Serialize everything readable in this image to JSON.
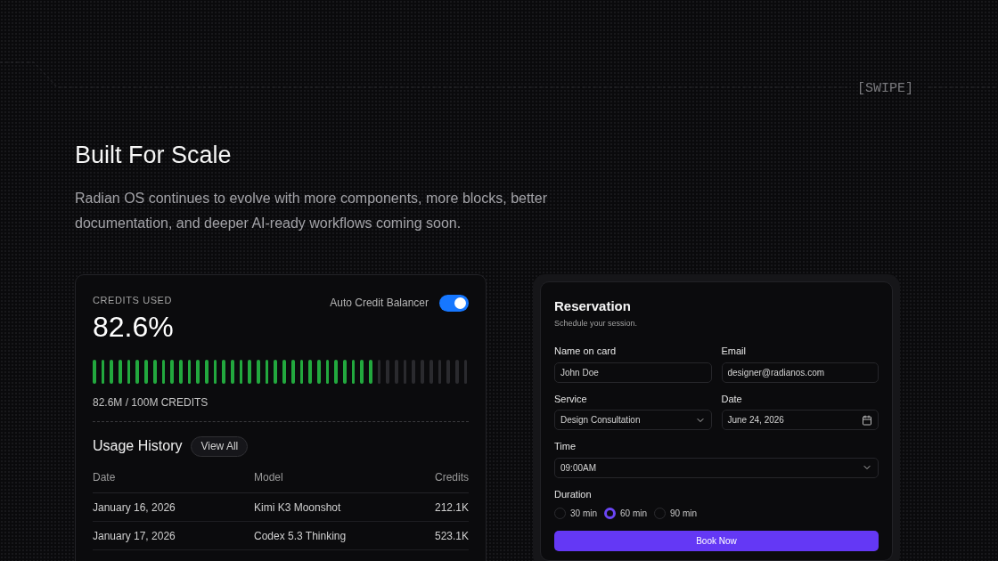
{
  "swipe_label": "[SWIPE]",
  "hero": {
    "title": "Built For Scale",
    "description": "Radian OS continues to evolve with more components, more blocks, better documentation, and deeper AI-ready workflows coming soon."
  },
  "credits_card": {
    "label": "CREDITS USED",
    "percent": "82.6%",
    "toggle": {
      "label": "Auto Credit Balancer",
      "on": true
    },
    "meter": {
      "level": 0.76
    },
    "usage": "82.6M / 100M CREDITS",
    "history": {
      "title": "Usage History",
      "button": "View All",
      "columns": [
        "Date",
        "Model",
        "Credits"
      ],
      "rows": [
        [
          "January 16, 2026",
          "Kimi K3 Moonshot",
          "212.1K"
        ],
        [
          "January 17, 2026",
          "Codex 5.3 Thinking",
          "523.1K"
        ]
      ]
    }
  },
  "reservation": {
    "title": "Reservation",
    "subtitle": "Schedule your session.",
    "fields": [
      {
        "kind": "text",
        "label": "Name on card",
        "value": "John Doe"
      },
      {
        "kind": "text",
        "label": "Email",
        "value": "designer@radianos.com"
      },
      {
        "kind": "select",
        "label": "Service",
        "value": "Design Consultation"
      },
      {
        "kind": "date",
        "label": "Date",
        "value": "June 24, 2026"
      },
      {
        "kind": "select",
        "label": "Time",
        "value": "09:00AM",
        "wide": true
      }
    ],
    "duration": {
      "label": "Duration",
      "options": [
        {
          "label": "30 min",
          "selected": false
        },
        {
          "label": "60 min",
          "selected": true
        },
        {
          "label": "90 min",
          "selected": false
        }
      ]
    },
    "button": "Book Now"
  }
}
